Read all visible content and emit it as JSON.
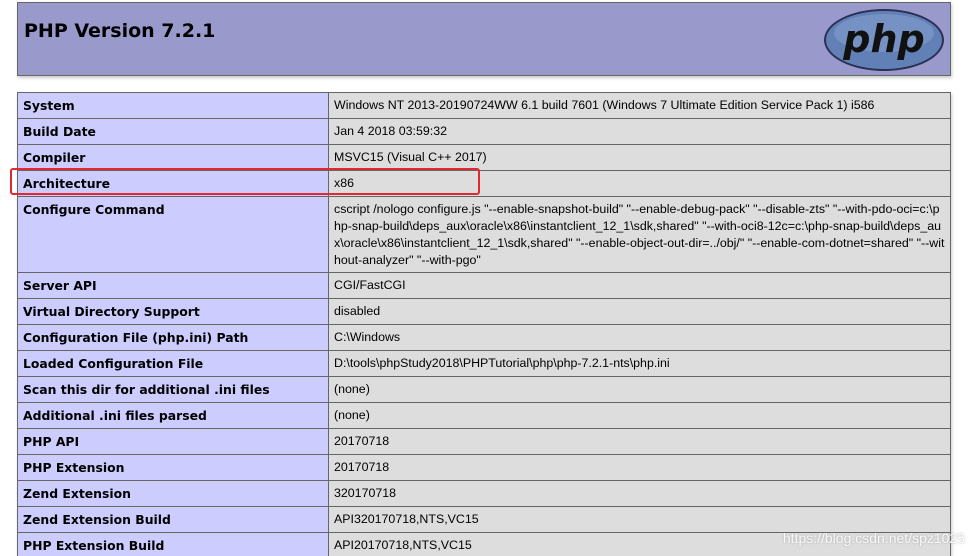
{
  "header": {
    "title": "PHP Version 7.2.1",
    "logo_text": "php"
  },
  "rows": [
    {
      "key": "System",
      "value": "Windows NT 2013-20190724WW 6.1 build 7601 (Windows 7 Ultimate Edition Service Pack 1) i586"
    },
    {
      "key": "Build Date",
      "value": "Jan 4 2018 03:59:32"
    },
    {
      "key": "Compiler",
      "value": "MSVC15 (Visual C++ 2017)"
    },
    {
      "key": "Architecture",
      "value": "x86"
    },
    {
      "key": "Configure Command",
      "value": "cscript /nologo configure.js \"--enable-snapshot-build\" \"--enable-debug-pack\" \"--disable-zts\" \"--with-pdo-oci=c:\\php-snap-build\\deps_aux\\oracle\\x86\\instantclient_12_1\\sdk,shared\" \"--with-oci8-12c=c:\\php-snap-build\\deps_aux\\oracle\\x86\\instantclient_12_1\\sdk,shared\" \"--enable-object-out-dir=../obj/\" \"--enable-com-dotnet=shared\" \"--without-analyzer\" \"--with-pgo\""
    },
    {
      "key": "Server API",
      "value": "CGI/FastCGI"
    },
    {
      "key": "Virtual Directory Support",
      "value": "disabled"
    },
    {
      "key": "Configuration File (php.ini) Path",
      "value": "C:\\Windows"
    },
    {
      "key": "Loaded Configuration File",
      "value": "D:\\tools\\phpStudy2018\\PHPTutorial\\php\\php-7.2.1-nts\\php.ini"
    },
    {
      "key": "Scan this dir for additional .ini files",
      "value": "(none)"
    },
    {
      "key": "Additional .ini files parsed",
      "value": "(none)"
    },
    {
      "key": "PHP API",
      "value": "20170718"
    },
    {
      "key": "PHP Extension",
      "value": "20170718"
    },
    {
      "key": "Zend Extension",
      "value": "320170718"
    },
    {
      "key": "Zend Extension Build",
      "value": "API320170718,NTS,VC15"
    },
    {
      "key": "PHP Extension Build",
      "value": "API20170718,NTS,VC15"
    }
  ],
  "highlight_row": "Architecture",
  "watermark": "https://blog.csdn.net/spz1025",
  "colors": {
    "header_bg": "#9999cc",
    "key_bg": "#ccccff",
    "value_bg": "#dddddd",
    "highlight": "#e0282e",
    "logo_bg": "#6181b6"
  }
}
